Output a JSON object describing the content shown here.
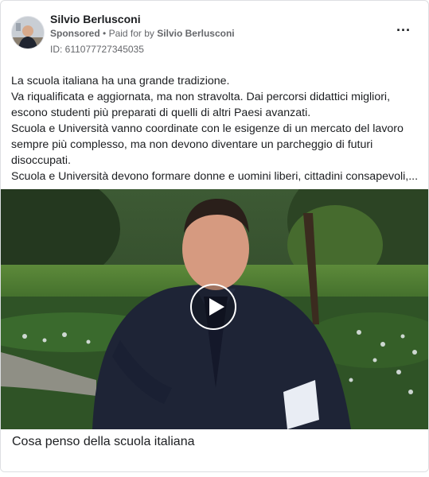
{
  "ad": {
    "page_name": "Silvio Berlusconi",
    "sponsored": "Sponsored",
    "separator": "•",
    "paid_for_prefix": "Paid for by",
    "paid_for_by": "Silvio Berlusconi",
    "ad_id": "ID: 611077727345035",
    "more_icon": "more-horizontal-icon",
    "more_label": "···"
  },
  "post": {
    "lines": [
      "La scuola italiana ha una grande tradizione.",
      "Va riqualificata e aggiornata, ma non stravolta. Dai percorsi didattici migliori,",
      "escono studenti più preparati di quelli di altri Paesi avanzati.",
      "Scuola e Università vanno coordinate con le esigenze di un mercato del lavoro",
      "sempre più complesso, ma non devono diventare un parcheggio di futuri",
      "disoccupati.",
      "Scuola e Università devono formare donne e uomini liberi, cittadini consapevoli,..."
    ]
  },
  "video": {
    "play_icon": "play-icon",
    "caption": "Cosa penso della scuola italiana"
  }
}
